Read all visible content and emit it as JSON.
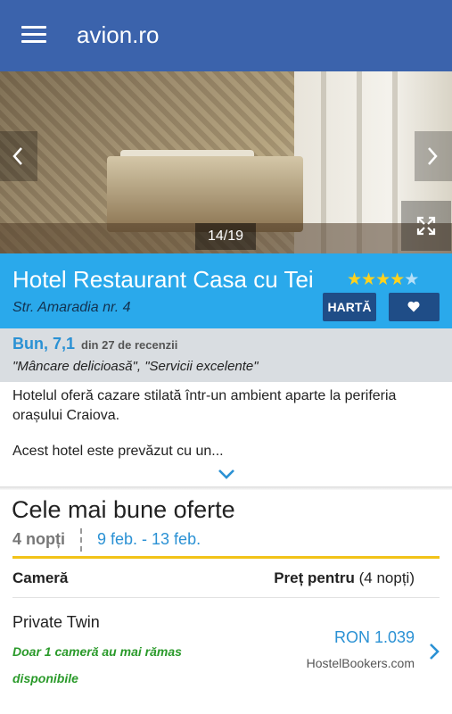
{
  "header": {
    "title": "avion.ro",
    "menu_icon": "hamburger-menu-icon"
  },
  "gallery": {
    "counter": "14/19",
    "prev_icon": "chevron-left-icon",
    "next_icon": "chevron-right-icon",
    "fullscreen_icon": "expand-icon"
  },
  "hotel": {
    "name": "Hotel Restaurant Casa cu Tei",
    "stars": 4,
    "stars_max": 5,
    "address": "Str. Amaradia nr. 4",
    "map_label": "HARTĂ",
    "favorite_icon": "heart-icon"
  },
  "reviews": {
    "score": "Bun, 7,1",
    "count": "din 27 de recenzii",
    "quotes": "\"Mâncare delicioasă\", \"Servicii excelente\""
  },
  "description": {
    "text": "Hotelul oferă cazare stilată într-un ambient aparte la periferia orașului Craiova.",
    "more": "Acest hotel este prevăzut cu un...",
    "expand_icon": "chevron-down-icon"
  },
  "offers": {
    "title": "Cele mai bune oferte",
    "nights": "4 nopți",
    "dates": "9 feb. - 13 feb.",
    "col_room": "Cameră",
    "col_price_bold": "Preț pentru",
    "col_price_rest": " (4 nopți)",
    "rooms": [
      {
        "name": "Private Twin",
        "availability": "Doar 1 cameră au mai rămas disponibile",
        "price": "RON 1.039",
        "provider": "HostelBookers.com"
      }
    ]
  },
  "colors": {
    "topbar": "#3b63ac",
    "hotel_header": "#2aa9eb",
    "button": "#1f4d87",
    "link": "#2a91d4",
    "accent_rule": "#f2c318",
    "availability": "#2a9a2a"
  }
}
